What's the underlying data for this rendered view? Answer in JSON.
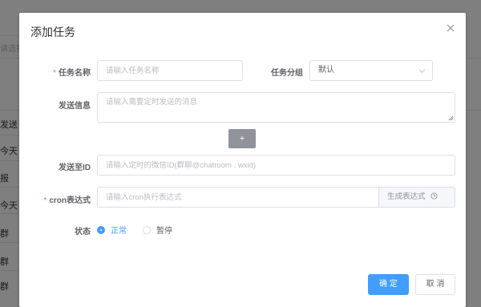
{
  "background": {
    "search_hint": "请选择",
    "rows": [
      "发送",
      "今天",
      "报",
      "今天",
      "群",
      "群",
      "群"
    ]
  },
  "dialog": {
    "title": "添加任务",
    "close_icon": "close-icon",
    "fields": {
      "task_name": {
        "label": "任务名称",
        "required": "*",
        "placeholder": "请输入任务名称",
        "value": ""
      },
      "task_group": {
        "label": "任务分组",
        "value": "默认"
      },
      "message": {
        "label": "发送信息",
        "placeholder": "请输入需要定时发送的消息",
        "value": ""
      },
      "add_button": "+",
      "send_to": {
        "label": "发送至ID",
        "placeholder": "请输入定时的微信ID(群聊@chatroom , wxid)",
        "value": ""
      },
      "cron": {
        "label": "cron表达式",
        "required": "*",
        "placeholder": "请输入cron执行表达式",
        "value": "",
        "generate_label": "生成表达式"
      },
      "status": {
        "label": "状态",
        "options": [
          "正常",
          "暂停"
        ],
        "selected": "正常"
      }
    },
    "footer": {
      "confirm_label": "确 定",
      "cancel_label": "取 消"
    }
  },
  "colors": {
    "primary": "#409eff",
    "required": "#f56c6c",
    "add_button": "#909399"
  }
}
